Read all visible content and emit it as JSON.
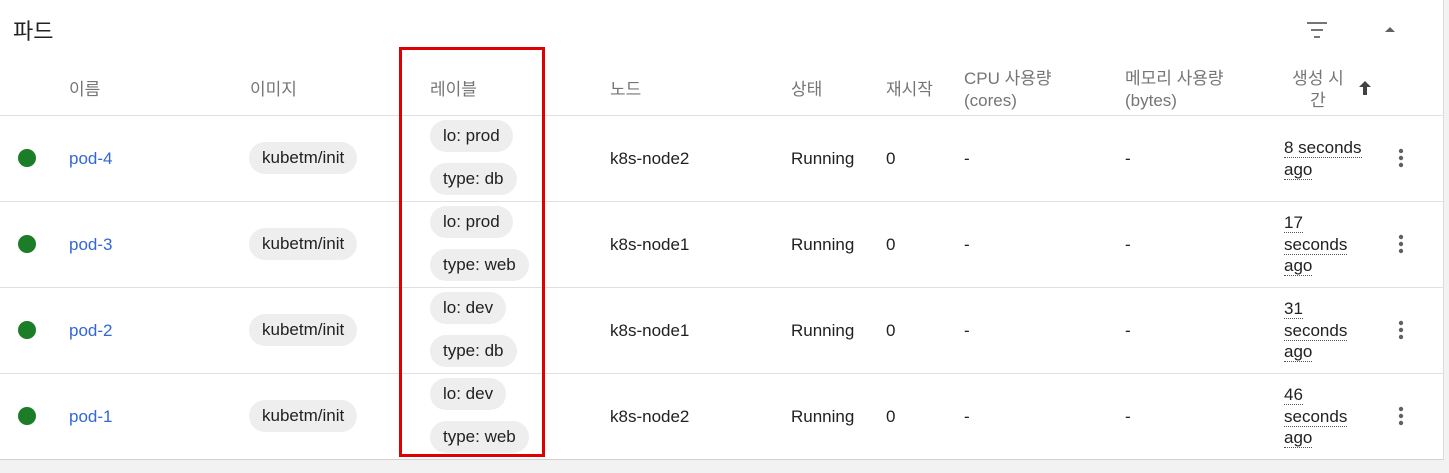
{
  "header": {
    "title": "파드",
    "filter_icon": "filter-icon",
    "collapse_icon": "chevron-up-icon"
  },
  "columns": {
    "name": "이름",
    "image": "이미지",
    "labels": "레이블",
    "node": "노드",
    "status": "상태",
    "restarts": "재시작",
    "cpu_line1": "CPU 사용량",
    "cpu_line2": "(cores)",
    "memory_line1": "메모리 사용량",
    "memory_line2": "(bytes)",
    "created_line1": "생성 시",
    "created_line2": "간",
    "sort_icon": "arrow-up-icon"
  },
  "rows": [
    {
      "status_color": "#1b7d27",
      "name": "pod-4",
      "image": "kubetm/init",
      "label1": "lo: prod",
      "label2": "type: db",
      "node": "k8s-node2",
      "status": "Running",
      "restarts": "0",
      "cpu": "-",
      "memory": "-",
      "age_lines": [
        "8 seconds",
        "ago"
      ]
    },
    {
      "status_color": "#1b7d27",
      "name": "pod-3",
      "image": "kubetm/init",
      "label1": "lo: prod",
      "label2": "type: web",
      "node": "k8s-node1",
      "status": "Running",
      "restarts": "0",
      "cpu": "-",
      "memory": "-",
      "age_lines": [
        "17",
        "seconds",
        "ago"
      ]
    },
    {
      "status_color": "#1b7d27",
      "name": "pod-2",
      "image": "kubetm/init",
      "label1": "lo: dev",
      "label2": "type: db",
      "node": "k8s-node1",
      "status": "Running",
      "restarts": "0",
      "cpu": "-",
      "memory": "-",
      "age_lines": [
        "31",
        "seconds",
        "ago"
      ]
    },
    {
      "status_color": "#1b7d27",
      "name": "pod-1",
      "image": "kubetm/init",
      "label1": "lo: dev",
      "label2": "type: web",
      "node": "k8s-node2",
      "status": "Running",
      "restarts": "0",
      "cpu": "-",
      "memory": "-",
      "age_lines": [
        "46",
        "seconds",
        "ago"
      ]
    }
  ],
  "colors": {
    "link": "#3367d6",
    "status_running": "#1b7d27",
    "chip_bg": "#eeeeee",
    "annotation_box": "#e10000"
  }
}
